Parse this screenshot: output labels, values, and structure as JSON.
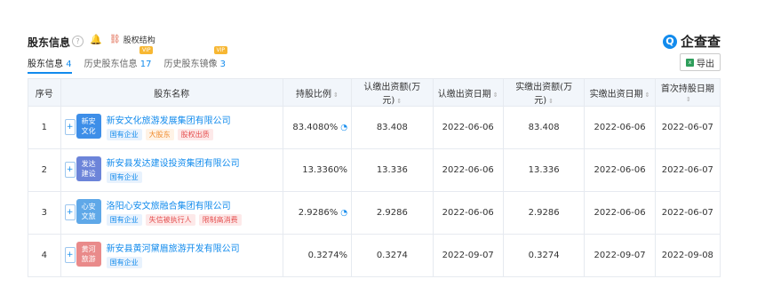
{
  "header": {
    "title": "股东信息",
    "equity_label": "股权结构",
    "brand": "企查查",
    "export_label": "导出"
  },
  "tabs": [
    {
      "label": "股东信息",
      "count": "4",
      "vip": ""
    },
    {
      "label": "历史股东信息",
      "count": "17",
      "vip": "VIP"
    },
    {
      "label": "历史股东镜像",
      "count": "3",
      "vip": "VIP"
    }
  ],
  "table": {
    "headers": [
      "序号",
      "股东名称",
      "持股比例",
      "认缴出资额(万元)",
      "认缴出资日期",
      "实缴出资额(万元)",
      "实缴出资日期",
      "首次持股日期"
    ],
    "rows": [
      {
        "index": "1",
        "logo_text": "新安\n文化",
        "logo_color": "#3d8ee8",
        "name": "新安文化旅游发展集团有限公司",
        "tags": [
          {
            "text": "国有企业",
            "type": "blue"
          },
          {
            "text": "大股东",
            "type": "orange"
          },
          {
            "text": "股权出质",
            "type": "red"
          }
        ],
        "ratio": "83.4080%",
        "sub_amount": "83.408",
        "sub_date": "2022-06-06",
        "paid_amount": "83.408",
        "paid_date": "2022-06-06",
        "first_date": "2022-06-07"
      },
      {
        "index": "2",
        "logo_text": "发达\n建设",
        "logo_color": "#6c84d9",
        "name": "新安县发达建设投资集团有限公司",
        "tags": [
          {
            "text": "国有企业",
            "type": "blue"
          }
        ],
        "ratio": "13.3360%",
        "sub_amount": "13.336",
        "sub_date": "2022-06-06",
        "paid_amount": "13.336",
        "paid_date": "2022-06-06",
        "first_date": "2022-06-07"
      },
      {
        "index": "3",
        "logo_text": "心安\n文旅",
        "logo_color": "#5fa8e8",
        "name": "洛阳心安文旅融合集团有限公司",
        "tags": [
          {
            "text": "国有企业",
            "type": "blue"
          },
          {
            "text": "失信被执行人",
            "type": "red"
          },
          {
            "text": "限制高消费",
            "type": "red"
          }
        ],
        "ratio": "2.9286%",
        "sub_amount": "2.9286",
        "sub_date": "2022-06-06",
        "paid_amount": "2.9286",
        "paid_date": "2022-06-06",
        "first_date": "2022-06-07"
      },
      {
        "index": "4",
        "logo_text": "黄河\n旅游",
        "logo_color": "#e98a8a",
        "name": "新安县黄河黛眉旅游开发有限公司",
        "tags": [
          {
            "text": "国有企业",
            "type": "blue"
          }
        ],
        "ratio": "0.3274%",
        "sub_amount": "0.3274",
        "sub_date": "2022-09-07",
        "paid_amount": "0.3274",
        "paid_date": "2022-09-07",
        "first_date": "2022-09-08"
      }
    ]
  }
}
